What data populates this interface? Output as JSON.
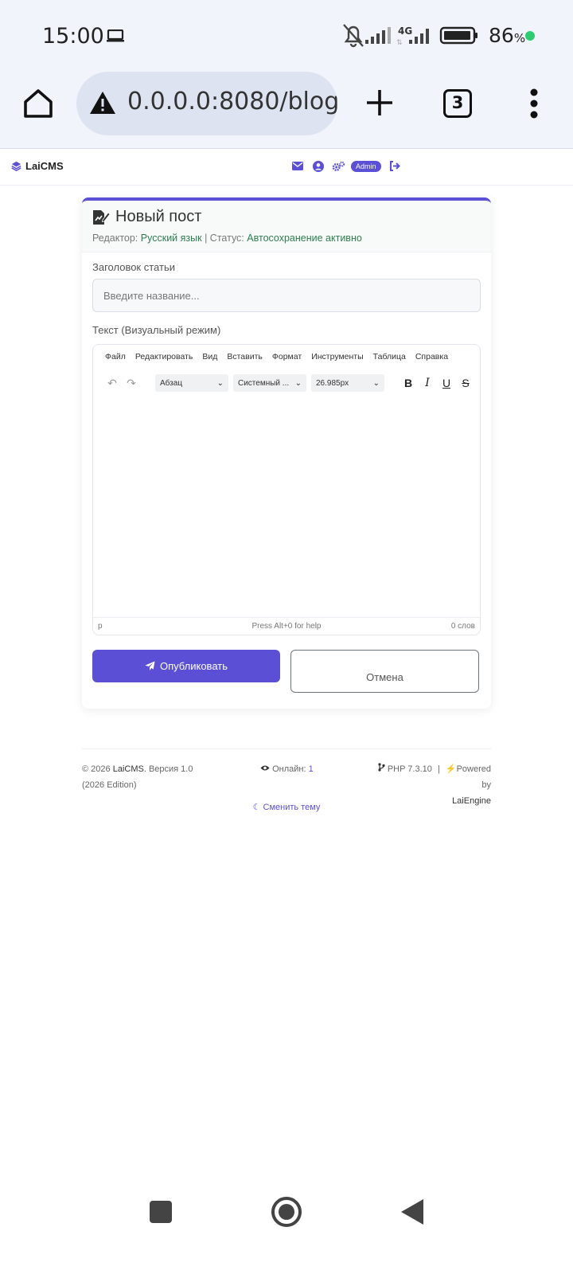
{
  "status_bar": {
    "time": "15:00",
    "battery": "86",
    "battery_unit": "%",
    "network": "4G"
  },
  "browser": {
    "url": "0.0.0.0:8080/blog/",
    "tab_count": "3"
  },
  "site": {
    "brand": "LaiCMS",
    "admin_badge": "Admin"
  },
  "card": {
    "title": "Новый пост",
    "sub_editor_label": "Редактор:",
    "sub_editor_value": "Русский язык",
    "sub_sep": "| Статус:",
    "sub_status_value": "Автосохранение активно",
    "title_label": "Заголовок статьи",
    "title_placeholder": "Введите название...",
    "text_label": "Текст (Визуальный режим)"
  },
  "editor": {
    "menu": [
      "Файл",
      "Редактировать",
      "Вид",
      "Вставить",
      "Формат",
      "Инструменты",
      "Таблица",
      "Справка"
    ],
    "block_format": "Абзац",
    "font_family": "Системный ...",
    "font_size": "26.985px",
    "status_path": "p",
    "status_help": "Press Alt+0 for help",
    "status_words": "0 слов"
  },
  "actions": {
    "publish": "Опубликовать",
    "cancel": "Отмена"
  },
  "footer": {
    "copyright_prefix": "© 2026",
    "brand": "LaiCMS",
    "version": ". Версия 1.0",
    "edition": "(2026 Edition)",
    "online_label": "Онлайн:",
    "online_count": "1",
    "php": "PHP 7.3.10",
    "sep": "|",
    "powered_by": "Powered by",
    "engine": "LaiEngine",
    "theme_toggle": "Сменить тему"
  },
  "colors": {
    "accent": "#5b4fd6",
    "status_green": "#2e7d4f"
  }
}
